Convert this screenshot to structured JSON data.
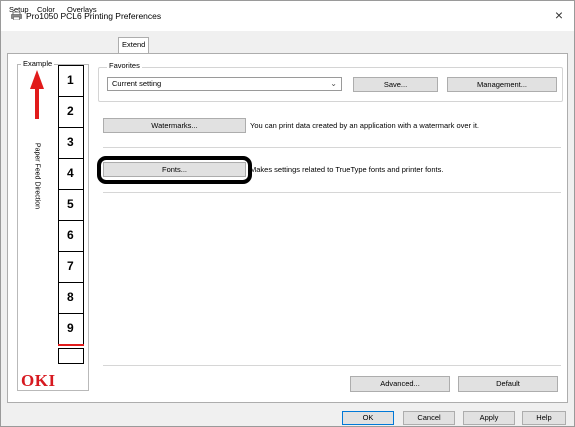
{
  "window": {
    "title": "Pro1050 PCL6 Printing Preferences",
    "close_glyph": "×",
    "app_icon": "printer-icon"
  },
  "tabs": [
    {
      "label": "Setup",
      "active": false
    },
    {
      "label": "Color",
      "active": false
    },
    {
      "label": "Overlays",
      "active": false
    },
    {
      "label": "Extend",
      "active": true
    }
  ],
  "example": {
    "label": "Example",
    "feed_direction_label": "Paper Feed Direction",
    "arrow_color": "#e11b1b",
    "pages": [
      "1",
      "2",
      "3",
      "4",
      "5",
      "6",
      "7",
      "8",
      "9"
    ]
  },
  "brand": {
    "logo_text": "OKI",
    "color": "#d71920"
  },
  "favorites": {
    "label": "Favorites",
    "selected": "Current setting",
    "save_label": "Save...",
    "management_label": "Management..."
  },
  "features": {
    "watermarks_label": "Watermarks...",
    "watermarks_desc": "You can print data created by an application with a watermark over it.",
    "fonts_label": "Fonts...",
    "fonts_desc": "Makes settings related to TrueType fonts and printer fonts."
  },
  "panel_actions": {
    "advanced_label": "Advanced...",
    "default_label": "Default"
  },
  "dialog_actions": {
    "ok_label": "OK",
    "cancel_label": "Cancel",
    "apply_label": "Apply",
    "help_label": "Help"
  },
  "highlight_color": "#000000"
}
